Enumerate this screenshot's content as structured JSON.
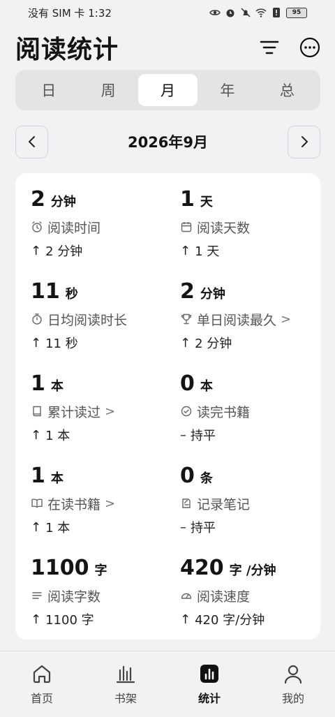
{
  "status_bar": {
    "carrier": "没有 SIM 卡",
    "time": "1:32",
    "battery": "95"
  },
  "header": {
    "title": "阅读统计"
  },
  "tabs": [
    {
      "label": "日",
      "active": false
    },
    {
      "label": "周",
      "active": false
    },
    {
      "label": "月",
      "active": true
    },
    {
      "label": "年",
      "active": false
    },
    {
      "label": "总",
      "active": false
    }
  ],
  "period": {
    "label": "2026年9月"
  },
  "stats": [
    {
      "num": "2",
      "unit": "分钟",
      "label": "阅读时间",
      "icon": "alarm-icon",
      "arrow": "↑",
      "change": "2 分钟",
      "chevron": ""
    },
    {
      "num": "1",
      "unit": "天",
      "label": "阅读天数",
      "icon": "calendar-icon",
      "arrow": "↑",
      "change": "1 天",
      "chevron": ""
    },
    {
      "num": "11",
      "unit": "秒",
      "label": "日均阅读时长",
      "icon": "stopwatch-icon",
      "arrow": "↑",
      "change": "11 秒",
      "chevron": ""
    },
    {
      "num": "2",
      "unit": "分钟",
      "label": "单日阅读最久",
      "icon": "trophy-icon",
      "arrow": "↑",
      "change": "2 分钟",
      "chevron": ">"
    },
    {
      "num": "1",
      "unit": "本",
      "label": "累计读过",
      "icon": "book-icon",
      "arrow": "↑",
      "change": "1 本",
      "chevron": ">"
    },
    {
      "num": "0",
      "unit": "本",
      "label": "读完书籍",
      "icon": "check-circle-icon",
      "arrow": "–",
      "change": "持平",
      "chevron": ""
    },
    {
      "num": "1",
      "unit": "本",
      "label": "在读书籍",
      "icon": "open-book-icon",
      "arrow": "↑",
      "change": "1 本",
      "chevron": ">"
    },
    {
      "num": "0",
      "unit": "条",
      "label": "记录笔记",
      "icon": "note-icon",
      "arrow": "–",
      "change": "持平",
      "chevron": ""
    },
    {
      "num": "1100",
      "unit": "字",
      "label": "阅读字数",
      "icon": "lines-icon",
      "arrow": "↑",
      "change": "1100 字",
      "chevron": ""
    },
    {
      "num": "420",
      "unit": "字 /分钟",
      "label": "阅读速度",
      "icon": "speed-icon",
      "arrow": "↑",
      "change": "420 字/分钟",
      "chevron": ""
    }
  ],
  "bottom_nav": [
    {
      "label": "首页",
      "icon": "home-icon",
      "active": false
    },
    {
      "label": "书架",
      "icon": "bookshelf-icon",
      "active": false
    },
    {
      "label": "统计",
      "icon": "stats-icon",
      "active": true
    },
    {
      "label": "我的",
      "icon": "profile-icon",
      "active": false
    }
  ]
}
